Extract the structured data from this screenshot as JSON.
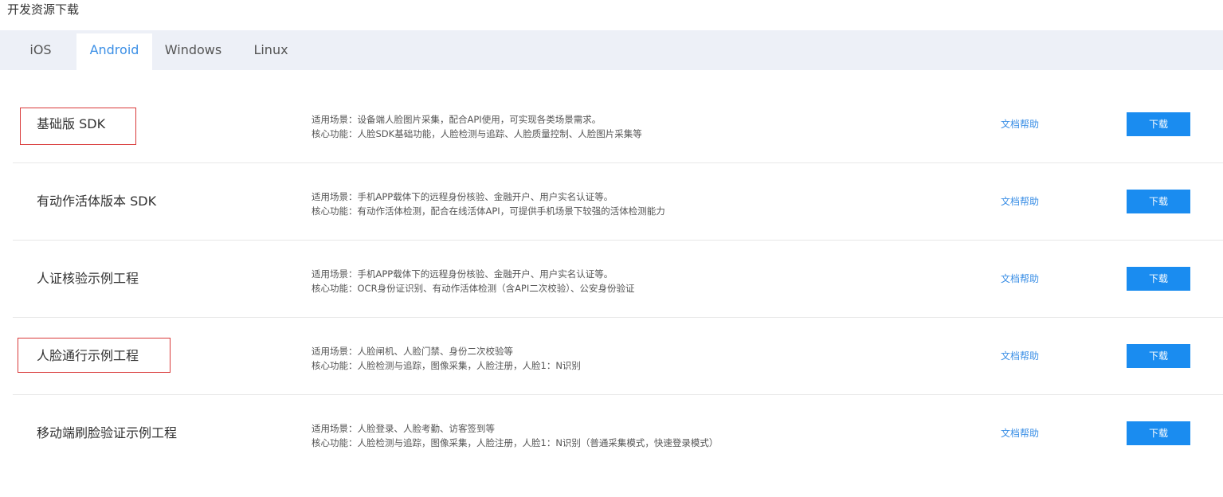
{
  "page": {
    "title": "开发资源下载"
  },
  "tabs": [
    {
      "label": "iOS",
      "active": false
    },
    {
      "label": "Android",
      "active": true
    },
    {
      "label": "Windows",
      "active": false
    },
    {
      "label": "Linux",
      "active": false
    }
  ],
  "rows": [
    {
      "name": "基础版 SDK",
      "scenario": "适用场景：设备端人脸图片采集，配合API使用，可实现各类场景需求。",
      "features": "核心功能：人脸SDK基础功能，人脸检测与追踪、人脸质量控制、人脸图片采集等",
      "doc_label": "文档帮助",
      "download_label": "下载",
      "highlighted": true
    },
    {
      "name": "有动作活体版本 SDK",
      "scenario": "适用场景：手机APP载体下的远程身份核验、金融开户、用户实名认证等。",
      "features": "核心功能：有动作活体检测，配合在线活体API，可提供手机场景下较强的活体检测能力",
      "doc_label": "文档帮助",
      "download_label": "下载",
      "highlighted": false
    },
    {
      "name": "人证核验示例工程",
      "scenario": "适用场景：手机APP载体下的远程身份核验、金融开户、用户实名认证等。",
      "features": "核心功能：OCR身份证识别、有动作活体检测（含API二次校验）、公安身份验证",
      "doc_label": "文档帮助",
      "download_label": "下载",
      "highlighted": false
    },
    {
      "name": "人脸通行示例工程",
      "scenario": "适用场景：人脸闸机、人脸门禁、身份二次校验等",
      "features": "核心功能：人脸检测与追踪，图像采集，人脸注册，人脸1：N识别",
      "doc_label": "文档帮助",
      "download_label": "下载",
      "highlighted": true
    },
    {
      "name": "移动端刷脸验证示例工程",
      "scenario": "适用场景：人脸登录、人脸考勤、访客签到等",
      "features": "核心功能：人脸检测与追踪，图像采集，人脸注册，人脸1：N识别（普通采集模式，快速登录模式）",
      "doc_label": "文档帮助",
      "download_label": "下载",
      "highlighted": false
    }
  ],
  "colors": {
    "accent": "#1a8cf0",
    "link": "#3b8fe6",
    "tab_bar_bg": "#edf0f7",
    "highlight_border": "#d93a3a"
  }
}
